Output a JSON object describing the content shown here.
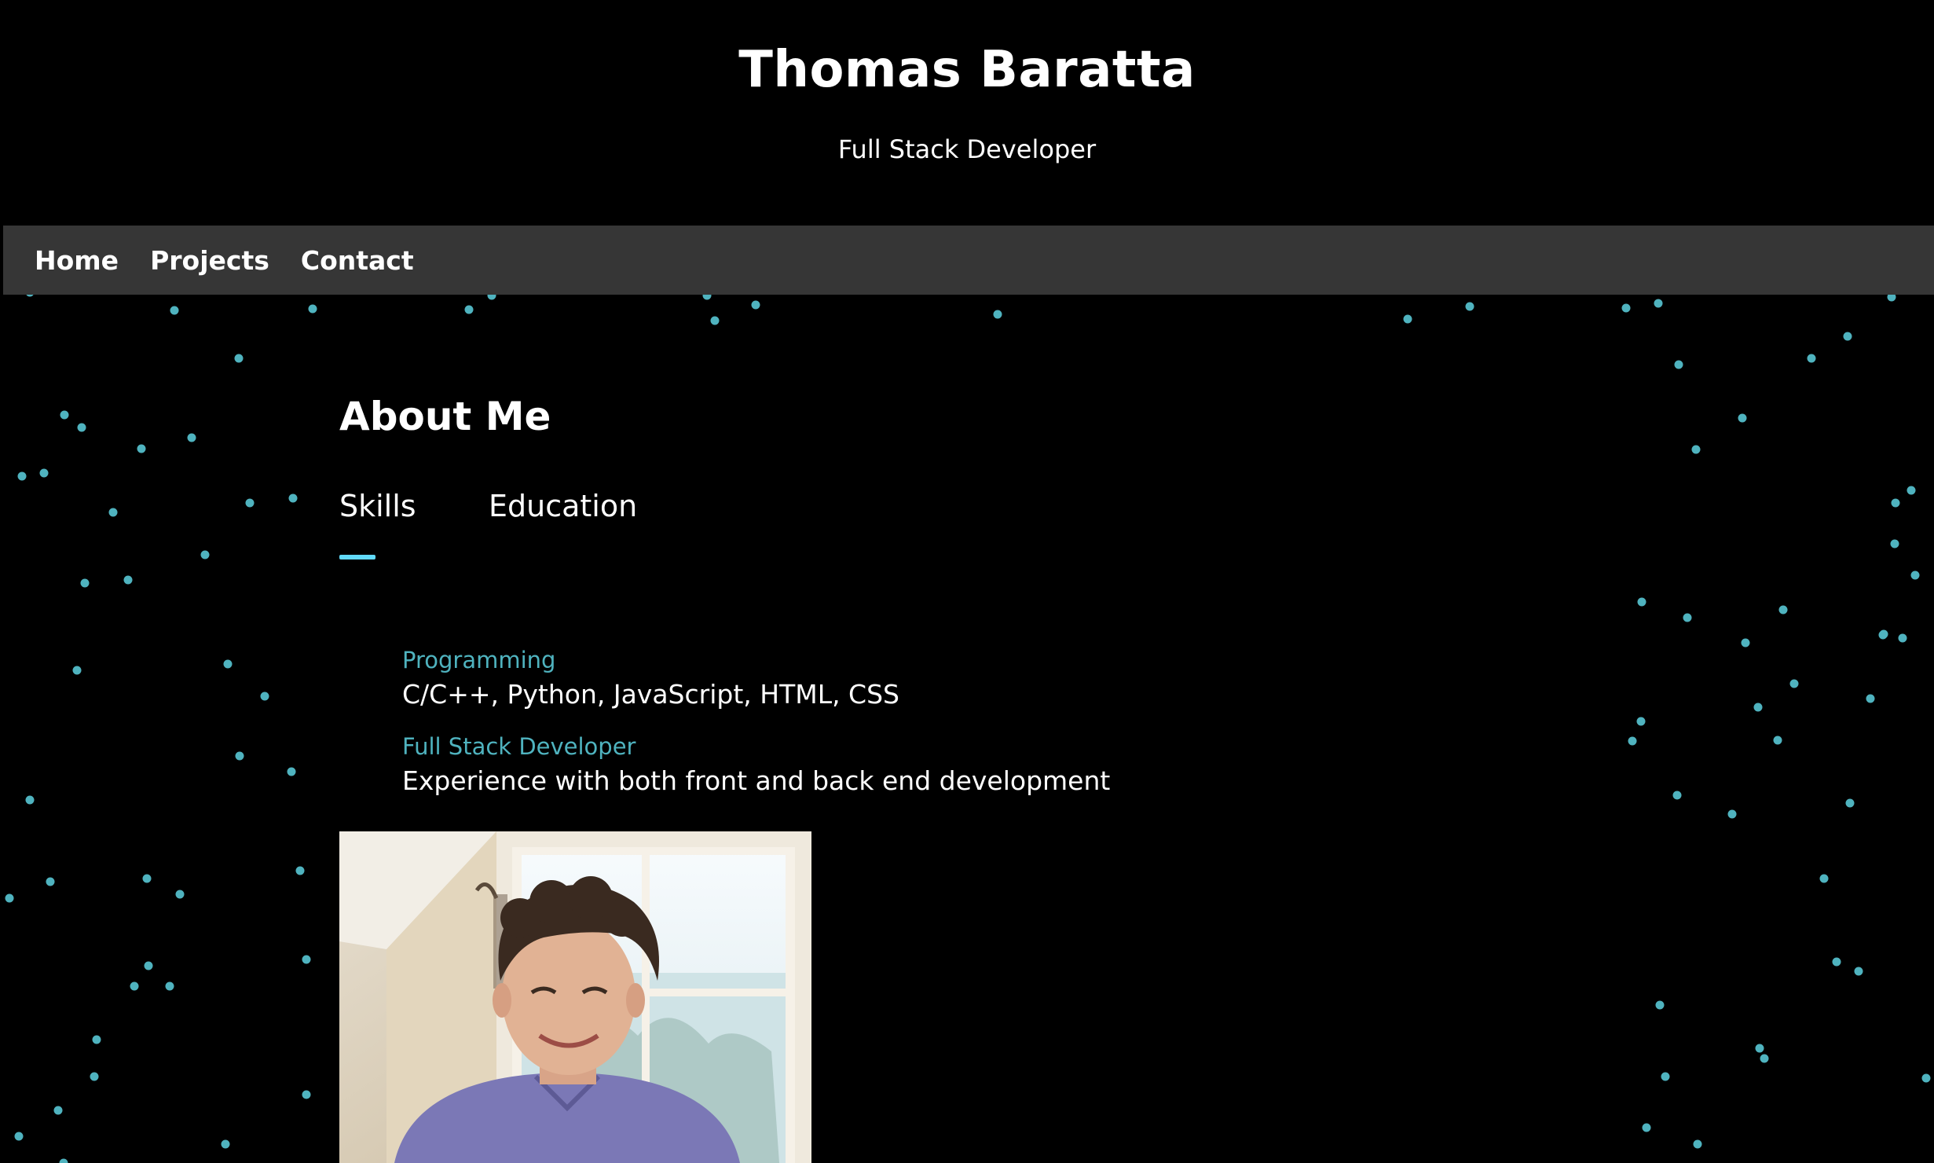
{
  "header": {
    "title": "Thomas Baratta",
    "subtitle": "Full Stack Developer"
  },
  "nav": {
    "items": [
      "Home",
      "Projects",
      "Contact"
    ]
  },
  "about": {
    "heading": "About Me",
    "tabs": [
      "Skills",
      "Education"
    ],
    "active_tab": "Skills",
    "skills": [
      {
        "title": "Programming",
        "detail": "C/C++, Python, JavaScript, HTML, CSS"
      },
      {
        "title": "Full Stack Developer",
        "detail": "Experience with both front and back end development"
      }
    ]
  },
  "colors": {
    "background": "#000000",
    "nav_background": "#363636",
    "accent": "#61dafb",
    "skill_title": "#4fb3bf",
    "particle": "#4fb3bf"
  },
  "photo": {
    "icon": "profile-photo"
  }
}
